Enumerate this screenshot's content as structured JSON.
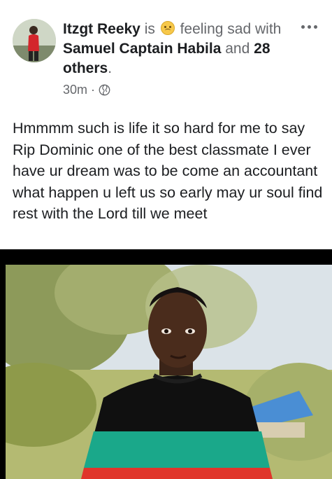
{
  "post": {
    "author": "Itzgt Reeky",
    "is_word": "is",
    "feeling": "feeling sad",
    "with_word": "with",
    "tagged_person": "Samuel Captain Habila",
    "and_word": "and",
    "others": "28 others",
    "period": ".",
    "time": "30m",
    "separator": "·",
    "privacy_icon": "globe-icon",
    "feeling_icon": "sad-face-icon",
    "more_icon": "more-dots-icon",
    "text": "Hmmmm such is life it so hard for me to say Rip Dominic one of the best classmate I ever have ur dream was to be come an accountant what happen u left us so early may ur soul find rest with the Lord till we meet"
  },
  "colors": {
    "text_primary": "#1c1e21",
    "text_secondary": "#65676b",
    "emoji_yellow": "#f7c84a",
    "shirt_black": "#101010",
    "shirt_green": "#1aa88a",
    "shirt_red": "#e0352b"
  }
}
